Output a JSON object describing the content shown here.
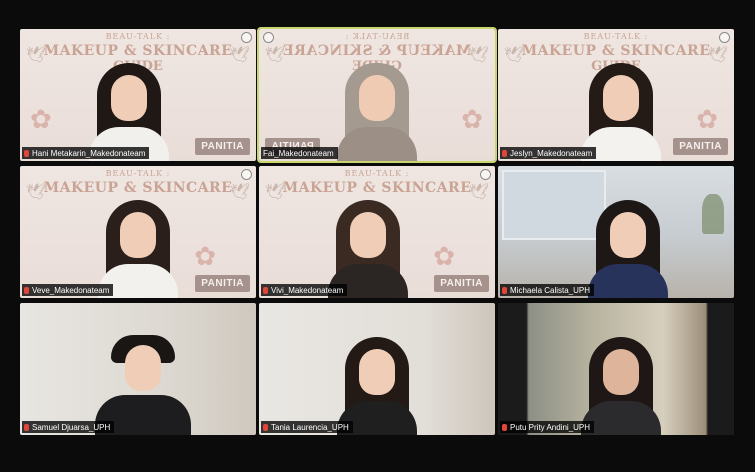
{
  "banner": {
    "line1": "BEAU-TALK :",
    "line2": "MAKEUP & SKINCARE",
    "line3": "GUIDE",
    "badge": "PANITIA"
  },
  "participants": [
    {
      "name": "Hani Metakarin_Makedonateam",
      "muted": true
    },
    {
      "name": "Fai_Makedonateam",
      "muted": false,
      "active_speaker": true
    },
    {
      "name": "Jeslyn_Makedonateam",
      "muted": true
    },
    {
      "name": "Veve_Makedonateam",
      "muted": true
    },
    {
      "name": "Vivi_Makedonateam",
      "muted": true
    },
    {
      "name": "Michaela Calista_UPH",
      "muted": true
    },
    {
      "name": "Samuel Djuarsa_UPH",
      "muted": true
    },
    {
      "name": "Tania Laurencia_UPH",
      "muted": true
    },
    {
      "name": "Putu Prity Andini_UPH",
      "muted": true
    }
  ],
  "colors": {
    "background": "#0b0b0b",
    "active_border": "#c9d66e",
    "muted_mic": "#e0453a",
    "banner_text": "#c9a394",
    "badge": "#a5928c"
  },
  "icons": {
    "muted": "mic-muted-icon",
    "bird": "bird-icon",
    "flower": "flower-icon"
  }
}
